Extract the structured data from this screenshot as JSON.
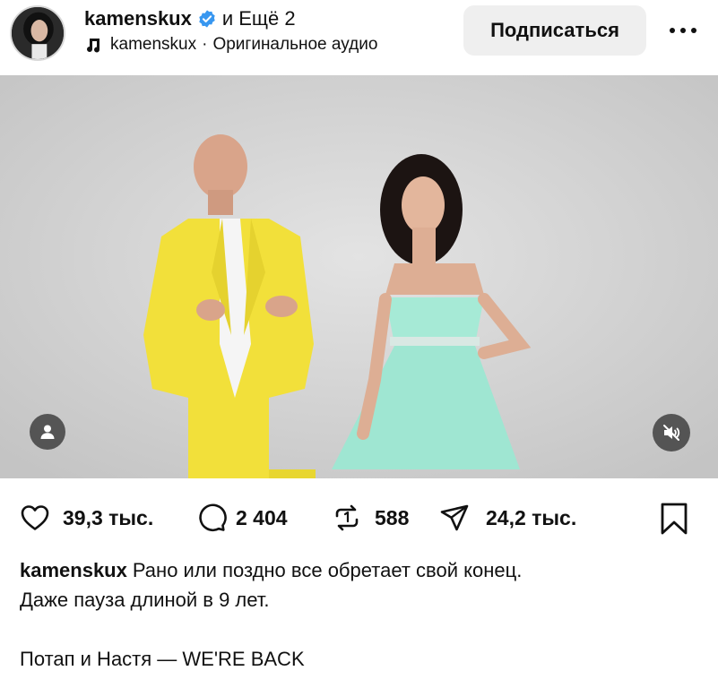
{
  "post": {
    "author": {
      "username": "kamenskux",
      "verified": true,
      "coauthors_text": "и Ещё 2",
      "avatar_icon": "avatar-portrait-icon"
    },
    "audio": {
      "icon": "music-note-icon",
      "artist": "kamenskux",
      "separator": "·",
      "title": "Оригинальное аудио"
    },
    "follow_label": "Подписаться",
    "more_icon": "more-dots-icon",
    "media": {
      "type": "video",
      "tag_users_icon": "user-tag-icon",
      "mute_icon": "muted-speaker-icon"
    },
    "stats": {
      "likes": "39,3 тыс.",
      "comments": "2 404",
      "reposts": "588",
      "shares": "24,2 тыс."
    },
    "caption": {
      "username": "kamenskux",
      "line1": "Рано или поздно все обретает свой конец.",
      "line2": "Даже пауза длиной в 9 лет.",
      "line3": "Потап и Настя — WE'RE BACK"
    }
  },
  "colors": {
    "verified_badge": "#3897f0",
    "follow_button_bg": "#efefef",
    "background": "#ffffff",
    "suit_yellow": "#f2e03a",
    "dress_mint": "#9fe6d2"
  }
}
